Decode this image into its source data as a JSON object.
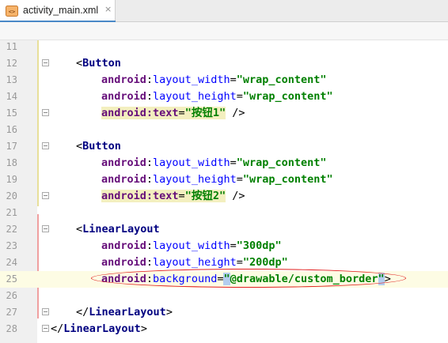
{
  "tab": {
    "filename": "activity_main.xml",
    "close_glyph": "×",
    "file_icon": "xml-file-icon"
  },
  "colors": {
    "tag": "#000080",
    "attribute": "#0000ff",
    "value": "#008000",
    "annotation": "#e21f1f"
  },
  "lines": [
    {
      "num": "11",
      "tokens": []
    },
    {
      "num": "12",
      "tokens": [
        {
          "t": "<",
          "c": "punct"
        },
        {
          "t": "Button",
          "c": "tag"
        }
      ]
    },
    {
      "num": "13",
      "tokens": [
        {
          "t": "android",
          "c": "ns"
        },
        {
          "t": ":",
          "c": "punct"
        },
        {
          "t": "layout_width",
          "c": "attr"
        },
        {
          "t": "=",
          "c": "punct"
        },
        {
          "t": "\"wrap_content\"",
          "c": "val"
        }
      ]
    },
    {
      "num": "14",
      "tokens": [
        {
          "t": "android",
          "c": "ns"
        },
        {
          "t": ":",
          "c": "punct"
        },
        {
          "t": "layout_height",
          "c": "attr"
        },
        {
          "t": "=",
          "c": "punct"
        },
        {
          "t": "\"wrap_content\"",
          "c": "val"
        }
      ]
    },
    {
      "num": "15",
      "tokens": [
        {
          "t": "android:text",
          "c": "ns",
          "hl": "attr"
        },
        {
          "t": "=",
          "c": "punct",
          "hl": "attr"
        },
        {
          "t": "\"按钮1\"",
          "c": "val",
          "hl": "attr"
        },
        {
          "t": " />",
          "c": "punct"
        }
      ]
    },
    {
      "num": "16",
      "tokens": []
    },
    {
      "num": "17",
      "tokens": [
        {
          "t": "<",
          "c": "punct"
        },
        {
          "t": "Button",
          "c": "tag"
        }
      ]
    },
    {
      "num": "18",
      "tokens": [
        {
          "t": "android",
          "c": "ns"
        },
        {
          "t": ":",
          "c": "punct"
        },
        {
          "t": "layout_width",
          "c": "attr"
        },
        {
          "t": "=",
          "c": "punct"
        },
        {
          "t": "\"wrap_content\"",
          "c": "val"
        }
      ]
    },
    {
      "num": "19",
      "tokens": [
        {
          "t": "android",
          "c": "ns"
        },
        {
          "t": ":",
          "c": "punct"
        },
        {
          "t": "layout_height",
          "c": "attr"
        },
        {
          "t": "=",
          "c": "punct"
        },
        {
          "t": "\"wrap_content\"",
          "c": "val"
        }
      ]
    },
    {
      "num": "20",
      "tokens": [
        {
          "t": "android:text",
          "c": "ns",
          "hl": "attr"
        },
        {
          "t": "=",
          "c": "punct",
          "hl": "attr"
        },
        {
          "t": "\"按钮2\"",
          "c": "val",
          "hl": "attr"
        },
        {
          "t": " />",
          "c": "punct"
        }
      ]
    },
    {
      "num": "21",
      "tokens": []
    },
    {
      "num": "22",
      "tokens": [
        {
          "t": "<",
          "c": "punct"
        },
        {
          "t": "LinearLayout",
          "c": "tag"
        }
      ]
    },
    {
      "num": "23",
      "tokens": [
        {
          "t": "android",
          "c": "ns"
        },
        {
          "t": ":",
          "c": "punct"
        },
        {
          "t": "layout_width",
          "c": "attr"
        },
        {
          "t": "=",
          "c": "punct"
        },
        {
          "t": "\"300dp\"",
          "c": "val"
        }
      ]
    },
    {
      "num": "24",
      "tokens": [
        {
          "t": "android",
          "c": "ns"
        },
        {
          "t": ":",
          "c": "punct"
        },
        {
          "t": "layout_height",
          "c": "attr"
        },
        {
          "t": "=",
          "c": "punct"
        },
        {
          "t": "\"200dp\"",
          "c": "val"
        }
      ]
    },
    {
      "num": "25",
      "tokens": [
        {
          "t": "android",
          "c": "ns"
        },
        {
          "t": ":",
          "c": "punct"
        },
        {
          "t": "background",
          "c": "attr"
        },
        {
          "t": "=",
          "c": "punct"
        },
        {
          "t": "\"",
          "c": "val",
          "hl": "quote"
        },
        {
          "t": "@drawable/custom_border",
          "c": "val"
        },
        {
          "t": "\"",
          "c": "val",
          "hl": "quote"
        },
        {
          "t": ">",
          "c": "punct"
        }
      ]
    },
    {
      "num": "26",
      "tokens": []
    },
    {
      "num": "27",
      "tokens": [
        {
          "t": "</",
          "c": "punct"
        },
        {
          "t": "LinearLayout",
          "c": "tag"
        },
        {
          "t": ">",
          "c": "punct"
        }
      ]
    },
    {
      "num": "28",
      "tokens": [
        {
          "t": "</",
          "c": "punct"
        },
        {
          "t": "LinearLayout",
          "c": "tag"
        },
        {
          "t": ">",
          "c": "punct"
        }
      ]
    }
  ]
}
